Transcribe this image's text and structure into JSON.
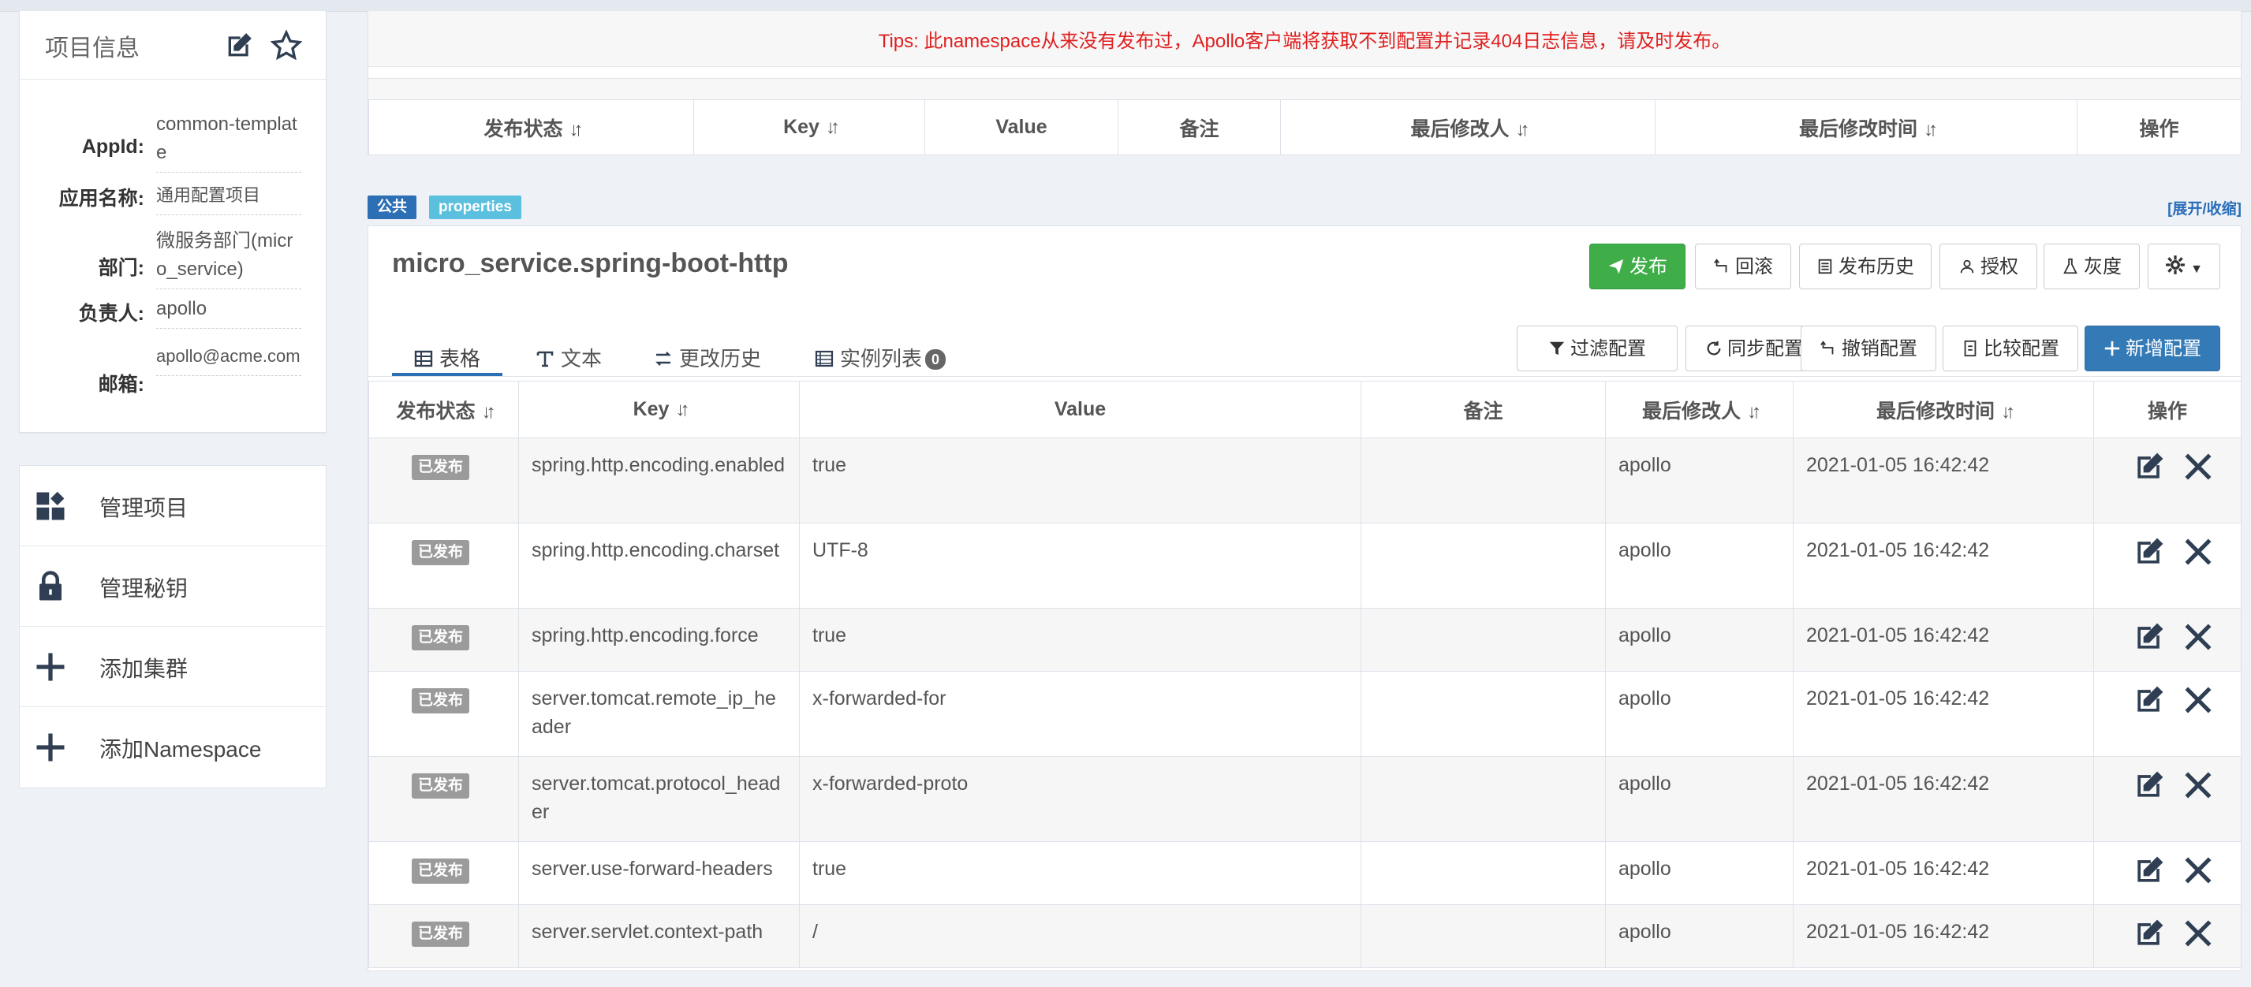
{
  "project_info": {
    "title": "项目信息",
    "edit_icon": "edit-icon",
    "favorite_icon": "star-icon",
    "fields": [
      {
        "label": "AppId:",
        "value": "common-template"
      },
      {
        "label": "应用名称:",
        "value": "通用配置项目"
      },
      {
        "label": "部门:",
        "value": "微服务部门(micro_service)"
      },
      {
        "label": "负责人:",
        "value": "apollo"
      },
      {
        "label": "邮箱:",
        "value": "apollo@acme.com"
      }
    ]
  },
  "nav": [
    {
      "label": "管理项目",
      "icon": "grid-icon"
    },
    {
      "label": "管理秘钥",
      "icon": "lock-icon"
    },
    {
      "label": "添加集群",
      "icon": "plus-icon"
    },
    {
      "label": "添加Namespace",
      "icon": "plus-icon"
    }
  ],
  "prev_namespace": {
    "tips": "Tips: 此namespace从来没有发布过，Apollo客户端将获取不到配置并记录404日志信息，请及时发布。",
    "columns": [
      "发布状态",
      "Key",
      "Value",
      "备注",
      "最后修改人",
      "最后修改时间",
      "操作"
    ]
  },
  "namespace": {
    "public_label": "公共",
    "format_label": "properties",
    "expand_toggle": "[展开/收缩]",
    "name": "micro_service.spring-boot-http",
    "actions": {
      "publish": "发布",
      "rollback": "回滚",
      "history": "发布历史",
      "authorize": "授权",
      "gray": "灰度"
    },
    "tabs": [
      {
        "label": "表格",
        "icon": "table-icon"
      },
      {
        "label": "文本",
        "icon": "text-icon"
      },
      {
        "label": "更改历史",
        "icon": "history-icon"
      },
      {
        "label": "实例列表",
        "icon": "instances-icon",
        "count": "0"
      }
    ],
    "tools": {
      "filter": "过滤配置",
      "sync": "同步配置",
      "revoke": "撤销配置",
      "compare": "比较配置",
      "add": "新增配置"
    },
    "columns": [
      "发布状态",
      "Key",
      "Value",
      "备注",
      "最后修改人",
      "最后修改时间",
      "操作"
    ],
    "rows": [
      {
        "status": "已发布",
        "key": "spring.http.encoding.enabled",
        "value": "true",
        "comment": "",
        "modifier": "apollo",
        "time": "2021-01-05 16:42:42"
      },
      {
        "status": "已发布",
        "key": "spring.http.encoding.charset",
        "value": "UTF-8",
        "comment": "",
        "modifier": "apollo",
        "time": "2021-01-05 16:42:42"
      },
      {
        "status": "已发布",
        "key": "spring.http.encoding.force",
        "value": "true",
        "comment": "",
        "modifier": "apollo",
        "time": "2021-01-05 16:42:42"
      },
      {
        "status": "已发布",
        "key": "server.tomcat.remote_ip_header",
        "value": "x-forwarded-for",
        "comment": "",
        "modifier": "apollo",
        "time": "2021-01-05 16:42:42"
      },
      {
        "status": "已发布",
        "key": "server.tomcat.protocol_header",
        "value": "x-forwarded-proto",
        "comment": "",
        "modifier": "apollo",
        "time": "2021-01-05 16:42:42"
      },
      {
        "status": "已发布",
        "key": "server.use-forward-headers",
        "value": "true",
        "comment": "",
        "modifier": "apollo",
        "time": "2021-01-05 16:42:42"
      },
      {
        "status": "已发布",
        "key": "server.servlet.context-path",
        "value": "/",
        "comment": "",
        "modifier": "apollo",
        "time": "2021-01-05 16:42:42"
      }
    ]
  },
  "colors": {
    "primary": "#337ab7",
    "success": "#3fae49",
    "danger_text": "#e02020",
    "badge_gray": "#9b9b9b",
    "info": "#5bc0de"
  }
}
